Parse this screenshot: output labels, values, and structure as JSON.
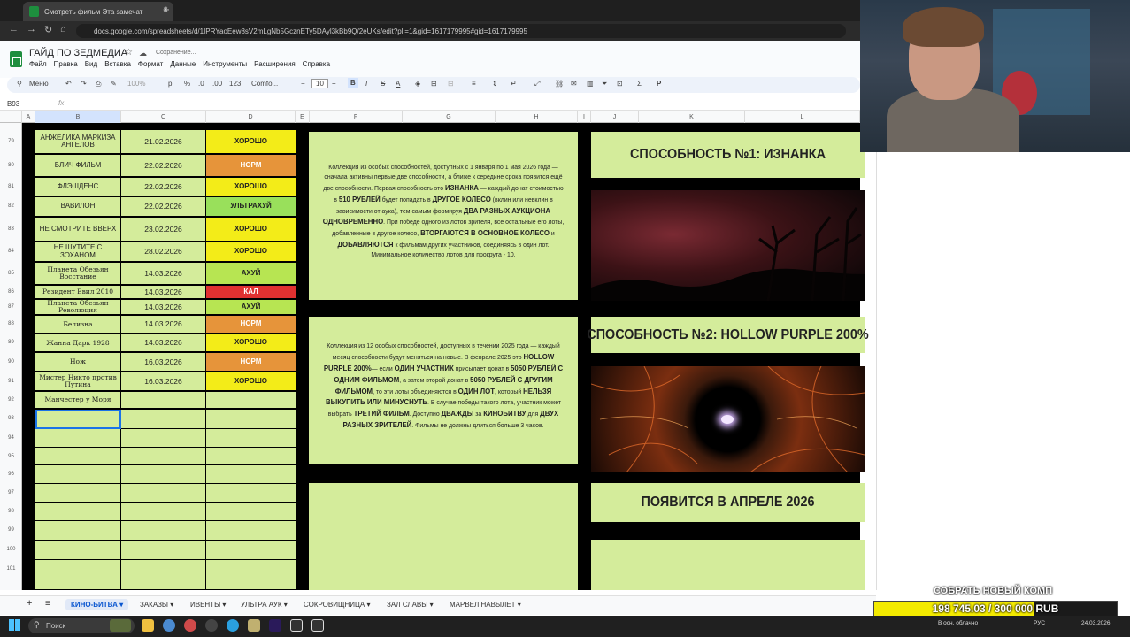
{
  "browser": {
    "tab_title": "Смотреть фильм Эта замечат",
    "new_tab": "+",
    "close": "×",
    "url": "docs.google.com/spreadsheets/d/1IPRYaoEew8sV2mLgNb5GcznETy5DAyl3kBb9Q/2eUKs/edit?pli=1&gid=1617179995#gid=1617179995"
  },
  "sheets": {
    "doc_title": "ГАЙД ПО ЗЕДМЕДИА",
    "saving": "Сохранение...",
    "menus": [
      "Файл",
      "Правка",
      "Вид",
      "Вставка",
      "Формат",
      "Данные",
      "Инструменты",
      "Расширения",
      "Справка"
    ],
    "toolbar": {
      "menu": "Меню",
      "zoom": "100%",
      "currency": "р.",
      "percent": "%",
      "dec_less": ".0",
      "dec_more": ".00",
      "num_format": "123",
      "font": "Comfo...",
      "font_size": "10",
      "bold": "B",
      "italic": "I",
      "strike": "S",
      "text_color": "A"
    },
    "cell_ref": "B93",
    "fx": "fx",
    "columns": [
      "A",
      "B",
      "C",
      "D",
      "E",
      "F",
      "G",
      "H",
      "I",
      "J",
      "K",
      "L"
    ]
  },
  "rows": [
    {
      "num": "79",
      "name": "АНЖЕЛИКА МАРКИЗА АНГЕЛОВ",
      "date": "21.02.2026",
      "status": "ХОРОШО",
      "style": "good",
      "script": false
    },
    {
      "num": "80",
      "name": "БЛИЧ ФИЛЬМ",
      "date": "22.02.2026",
      "status": "НОРМ",
      "style": "norm",
      "script": false
    },
    {
      "num": "81",
      "name": "ФЛЭШДЕНС",
      "date": "22.02.2026",
      "status": "ХОРОШО",
      "style": "good",
      "script": false
    },
    {
      "num": "82",
      "name": "ВАВИЛОН",
      "date": "22.02.2026",
      "status": "УЛЬТРАХУЙ",
      "style": "ultra",
      "script": false
    },
    {
      "num": "83",
      "name": "НЕ СМОТРИТЕ ВВЕРХ",
      "date": "23.02.2026",
      "status": "ХОРОШО",
      "style": "good",
      "script": false
    },
    {
      "num": "84",
      "name": "НЕ ШУТИТЕ С ЗОХАНОМ",
      "date": "28.02.2026",
      "status": "ХОРОШО",
      "style": "good",
      "script": false
    },
    {
      "num": "85",
      "name": "Планета Обезьян Восстание",
      "date": "14.03.2026",
      "status": "АХУЙ",
      "style": "ahui",
      "script": true
    },
    {
      "num": "86",
      "name": "Резидент Евил 2010",
      "date": "14.03.2026",
      "status": "КАЛ",
      "style": "kal",
      "script": true
    },
    {
      "num": "87",
      "name": "Планета Обезьян Революция",
      "date": "14.03.2026",
      "status": "АХУЙ",
      "style": "ahui",
      "script": true
    },
    {
      "num": "88",
      "name": "Белизна",
      "date": "14.03.2026",
      "status": "НОРМ",
      "style": "norm",
      "script": true
    },
    {
      "num": "89",
      "name": "Жанна Дарк 1928",
      "date": "14.03.2026",
      "status": "ХОРОШО",
      "style": "good",
      "script": true
    },
    {
      "num": "90",
      "name": "Нож",
      "date": "16.03.2026",
      "status": "НОРМ",
      "style": "norm",
      "script": true
    },
    {
      "num": "91",
      "name": "Мистер Никто против Путина",
      "date": "16.03.2026",
      "status": "ХОРОШО",
      "style": "good",
      "script": true
    },
    {
      "num": "92",
      "name": "Манчестер у Моря",
      "date": "",
      "status": "",
      "style": "empty",
      "script": true
    }
  ],
  "empty_row_nums": [
    "93",
    "94",
    "95",
    "96",
    "97",
    "98",
    "99",
    "100",
    "101"
  ],
  "panels": {
    "p1_text_parts": [
      "Коллекция из особых способностей, доступных с 1 января по 1 мая 2026 года — сначала активны первые две способности, а ближе к середине срока появится ещё две способности. Первая способность это ",
      "ИЗНАНКА",
      " — каждый донат стоимостью в ",
      "510 РУБЛЕЙ",
      " будет попадать в ",
      "ДРУГОЕ КОЛЕСО",
      " (вклин или невклин в зависимости от аука), тем самым формируя ",
      "ДВА РАЗНЫХ АУКЦИОНА ОДНОВРЕМЕННО",
      ". При победе одного из лотов зрителя, все остальные его лоты, добавленные в другое колесо, ",
      "ВТОРГАЮТСЯ В ОСНОВНОЕ КОЛЕСО",
      " и ",
      "ДОБАВЛЯЮТСЯ",
      " к фильмам других участников, соединяясь в один лот. Минимальное количество лотов для прокрута - 10."
    ],
    "p2_text_parts": [
      "Коллекция из 12 особых способностей, доступных в течении 2025 года — каждый месяц способности будут меняться на новые. В феврале 2025 это ",
      "HOLLOW PURPLE 200%",
      "— если ",
      "ОДИН УЧАСТНИК",
      " присылает донат в ",
      "5050 РУБЛЕЙ С ОДНИМ ФИЛЬМОМ",
      ", а затем второй донат в ",
      "5050 РУБЛЕЙ С ДРУГИМ ФИЛЬМОМ",
      ", то эти лоты объединяются в ",
      "ОДИН ЛОТ",
      ", который ",
      "НЕЛЬЗЯ ВЫКУПИТЬ ИЛИ МИНУСНУТЬ",
      ". В случае победы такого лота, участник может выбрать ",
      "ТРЕТИЙ ФИЛЬМ",
      ". Доступно ",
      "ДВАЖДЫ",
      " за ",
      "КИНОБИТВУ",
      " для ",
      "ДВУХ РАЗНЫХ ЗРИТЕЛЕЙ",
      ". Фильмы не должны длиться больше 3 часов."
    ],
    "title1": "СПОСОБНОСТЬ №1: ИЗНАНКА",
    "title2": "СПОСОБНОСТЬ №2: HOLLOW PURPLE 200%",
    "title3": "ПОЯВИТСЯ В АПРЕЛЕ 2026"
  },
  "sheet_tabs": [
    "КИНО-БИТВА",
    "ЗАКАЗЫ",
    "ИВЕНТЫ",
    "УЛЬТРА АУК",
    "СОКРОВИЩНИЦА",
    "ЗАЛ СЛАВЫ",
    "МАРВЕЛ НАВЫЛЕТ"
  ],
  "sheet_tab_add": "+",
  "sheet_tab_list": "≡",
  "donation": {
    "label": "СОБРАТЬ НОВЫЙ КОМП",
    "progress_text": "198 745.03 / 300 000 RUB",
    "progress_fraction": 0.66
  },
  "taskbar": {
    "search": "Поиск",
    "weather": "В осн. облачно",
    "lang": "РУС",
    "date": "24.03.2026"
  },
  "colors": {
    "panel_green": "#d4ec9b",
    "good": "#f3ec18",
    "norm": "#e6943a",
    "ultra": "#99e05b",
    "ahui": "#b7e552",
    "kal": "#e03131",
    "selection": "#1a73e8",
    "donation_yellow": "#f3ea00"
  }
}
